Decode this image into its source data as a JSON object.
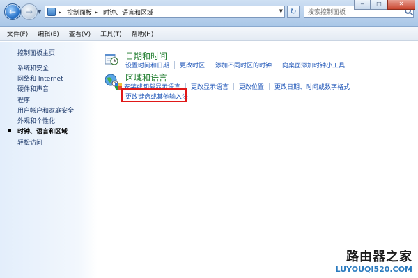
{
  "titlebar": {
    "breadcrumb": [
      "控制面板",
      "时钟、语言和区域"
    ],
    "search_placeholder": "搜索控制面板"
  },
  "menu": [
    "文件(F)",
    "编辑(E)",
    "查看(V)",
    "工具(T)",
    "帮助(H)"
  ],
  "sidebar": {
    "items": [
      {
        "label": "控制面板主页"
      },
      {
        "label": "系统和安全"
      },
      {
        "label": "网络和 Internet"
      },
      {
        "label": "硬件和声音"
      },
      {
        "label": "程序"
      },
      {
        "label": "用户帐户和家庭安全"
      },
      {
        "label": "外观和个性化"
      },
      {
        "label": "时钟、语言和区域",
        "current": true
      },
      {
        "label": "轻松访问"
      }
    ]
  },
  "main": {
    "categories": [
      {
        "title": "日期和时间",
        "icon": "calendar-clock-icon",
        "links": [
          "设置时间和日期",
          "更改时区",
          "添加不同时区的时钟",
          "向桌面添加时钟小工具"
        ]
      },
      {
        "title": "区域和语言",
        "icon": "globe-clock-icon",
        "links": [
          "安装或卸载显示语言",
          "更改显示语言",
          "更改位置",
          "更改日期、时间或数字格式"
        ],
        "extra_link": "更改键盘或其他输入法"
      }
    ]
  },
  "highlight_color": "#e01818",
  "watermark": {
    "logo": "路由器之家",
    "url": "LUYOUQI520.COM"
  }
}
